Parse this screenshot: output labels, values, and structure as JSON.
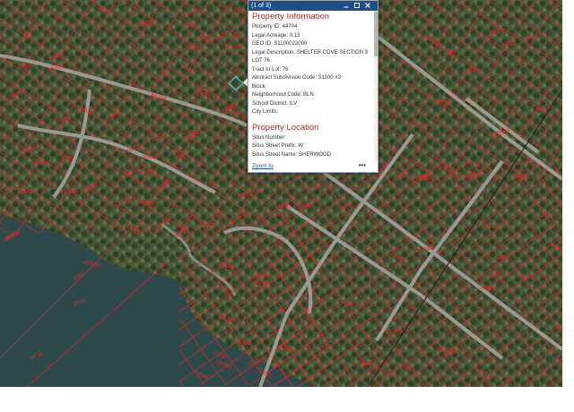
{
  "map": {
    "colors": {
      "water": "#2f4a4a",
      "land": "#4f5a3a",
      "road": "#9a9a90",
      "parcel_line": "#d8262b",
      "label": "#e8262b",
      "highlight": "#35d8e8",
      "popup_header": "#1f4f8a",
      "popup_title": "#a5312f"
    },
    "parcel_labels": [
      "44704",
      "90020",
      "32731",
      "37399",
      "47800",
      "18780",
      "2110",
      "6093",
      "3718",
      "22560",
      "17021",
      "1045",
      "9087",
      "4599",
      "12633",
      "20025",
      "7721",
      "15080",
      "3602",
      "89012",
      "47530",
      "88081",
      "25505",
      "14411"
    ]
  },
  "popup": {
    "counter": "(1 of 3)",
    "icons": [
      "collapse-icon",
      "maximize-icon",
      "close-icon"
    ],
    "section1_title": "Property Information",
    "rows": [
      {
        "label": "Property ID:",
        "value": "44704"
      },
      {
        "label": "Legal Acreage:",
        "value": "0.13"
      },
      {
        "label": "GEO ID:",
        "value": "S1100022000"
      },
      {
        "label": "Legal Description:",
        "value": "SHELTER COVE SECTION 3 LOT 76"
      },
      {
        "label": "Tract or Lot:",
        "value": "76"
      },
      {
        "label": "Abstract Subdivision Code:",
        "value": "S1100 #3"
      },
      {
        "label": "Block:",
        "value": ""
      },
      {
        "label": "Neighborhood Code:",
        "value": "BLN"
      },
      {
        "label": "School District:",
        "value": "ILV"
      },
      {
        "label": "City Limits:",
        "value": ""
      }
    ],
    "section2_title": "Property Location",
    "rows2": [
      {
        "label": "Situs Number:",
        "value": ""
      },
      {
        "label": "Situs Street Prefix:",
        "value": "W"
      },
      {
        "label": "Situs Street Name:",
        "value": "SHERWOOD"
      }
    ],
    "zoom_label": "Zoom to",
    "more_label": "•••"
  }
}
